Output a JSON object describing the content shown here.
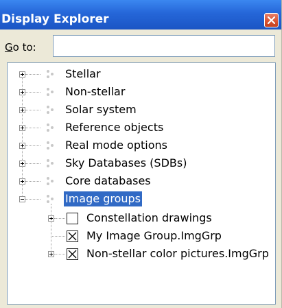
{
  "window": {
    "title": "Display Explorer"
  },
  "goto": {
    "label_accel": "G",
    "label_rest": "o to:",
    "value": ""
  },
  "tree": {
    "items": [
      {
        "label": "Stellar",
        "expanded": false
      },
      {
        "label": "Non-stellar",
        "expanded": false
      },
      {
        "label": "Solar system",
        "expanded": false
      },
      {
        "label": "Reference objects",
        "expanded": false
      },
      {
        "label": "Real mode options",
        "expanded": false
      },
      {
        "label": "Sky Databases (SDBs)",
        "expanded": false
      },
      {
        "label": "Core databases",
        "expanded": false
      },
      {
        "label": "Image groups",
        "expanded": true,
        "selected": true
      }
    ],
    "children": [
      {
        "label": "Constellation drawings",
        "checked": false,
        "expandable": true
      },
      {
        "label": "My Image Group.ImgGrp",
        "checked": true,
        "expandable": false
      },
      {
        "label": "Non-stellar color pictures.ImgGrp",
        "checked": true,
        "expandable": true
      }
    ]
  },
  "colors": {
    "titlebar": "#2566d8",
    "selection": "#316ac5",
    "close": "#d9512f"
  },
  "icons": {
    "expand": "plus-box-icon",
    "collapse": "minus-box-icon",
    "node": "star-cluster-icon",
    "close": "close-icon"
  }
}
